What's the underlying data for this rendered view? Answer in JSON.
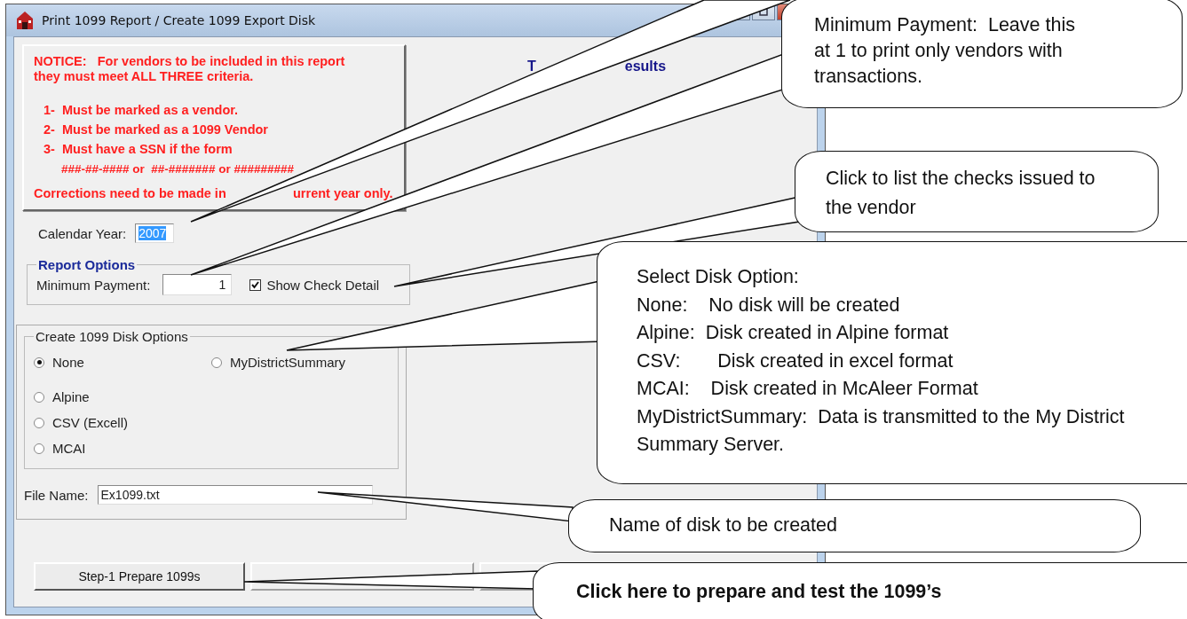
{
  "window": {
    "title": "Print 1099 Report / Create 1099 Export Disk"
  },
  "notice": {
    "heading": "NOTICE:   For vendors to be included in this report they must meet ALL THREE criteria.",
    "criteria": [
      {
        "number": "1-",
        "text": "Must be marked as a vendor."
      },
      {
        "number": "2-",
        "text": "Must be marked as a 1099 Vendor"
      },
      {
        "number": "3-",
        "text": "Must have a SSN if the form"
      }
    ],
    "formats": "###-##-#### or  ##-####### or #########",
    "footer_parts": [
      "Corrections need to be made in",
      "urrent year only."
    ]
  },
  "results": {
    "heading_parts": [
      "T",
      "esults"
    ]
  },
  "calendar": {
    "label": "Calendar Year:",
    "value": "2007",
    "value_selected": true
  },
  "report_options": {
    "title": "Report Options",
    "min_payment": {
      "label": "Minimum Payment:",
      "value": "1"
    },
    "show_check_detail": {
      "label": "Show Check Detail",
      "checked": true
    }
  },
  "disk_options": {
    "title": "Create 1099 Disk Options",
    "options": [
      {
        "label": "None",
        "selected": true
      },
      {
        "label": "MyDistrictSummary",
        "selected": false
      },
      {
        "label": "Alpine",
        "selected": false
      },
      {
        "label": "CSV (Excell)",
        "selected": false
      },
      {
        "label": "MCAI",
        "selected": false
      }
    ]
  },
  "file_name": {
    "label": "File Name:",
    "value": "Ex1099.txt"
  },
  "buttons": [
    {
      "label": "Step-1  Prepare 1099s",
      "disabled": false
    },
    {
      "disabled": true
    },
    {
      "disabled": true
    }
  ],
  "callouts": [
    {
      "lines": [
        "Minimum Payment:  Leave this at 1 to print only vendors with transactions."
      ]
    },
    {
      "lines": [
        "Click to list the checks issued to the vendor"
      ]
    },
    {
      "lines": [
        "Select Disk Option:",
        "None:    No disk will be created",
        "Alpine:  Disk created in Alpine format",
        "CSV:       Disk created in excel format",
        "MCAI:    Disk created in McAleer Format",
        "MyDistrictSummary:  Data is transmitted to the My District Summary Server."
      ]
    },
    {
      "lines": [
        "Name of disk to be created"
      ]
    },
    {
      "lines": [
        "Click here to prepare and test the 1099’s"
      ],
      "bold": true
    }
  ]
}
